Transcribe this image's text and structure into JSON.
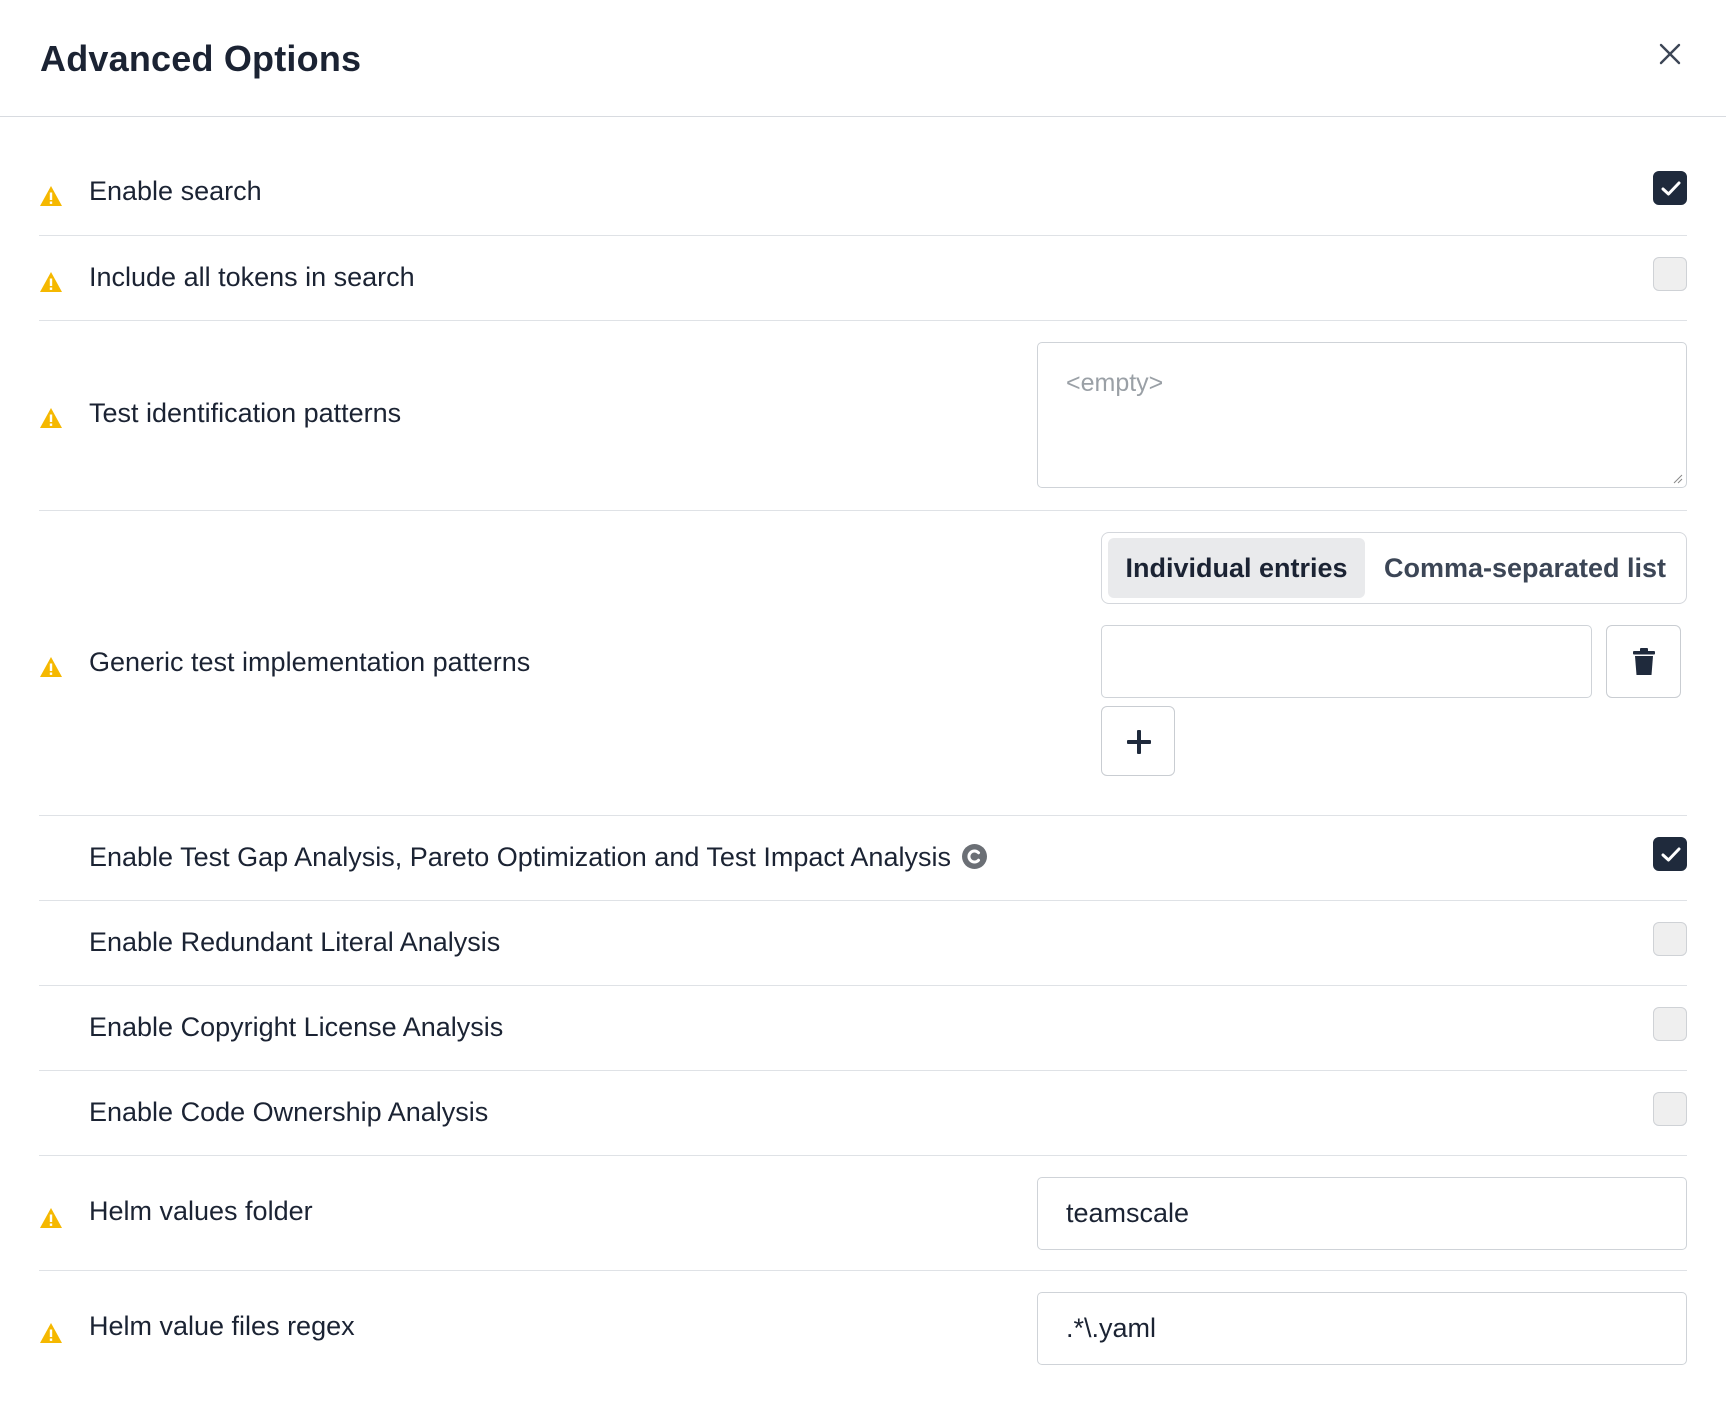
{
  "dialog": {
    "title": "Advanced Options",
    "close_icon": "close-icon"
  },
  "options": {
    "enable_search": {
      "label": "Enable search",
      "checked": true,
      "warning": true
    },
    "include_all_tokens": {
      "label": "Include all tokens in search",
      "checked": false,
      "warning": true
    },
    "test_identification_patterns": {
      "label": "Test identification patterns",
      "placeholder": "<empty>",
      "value": "",
      "warning": true
    },
    "generic_test_patterns": {
      "label": "Generic test implementation patterns",
      "warning": true,
      "modes": {
        "individual": "Individual entries",
        "comma": "Comma-separated list",
        "selected": "Individual entries"
      },
      "entry_value": "",
      "delete_icon": "trash-icon",
      "add_icon": "plus-icon"
    },
    "tga": {
      "label": "Enable Test Gap Analysis, Pareto Optimization and Test Impact Analysis",
      "checked": true,
      "badge_icon": "c-badge-icon"
    },
    "redundant_literal": {
      "label": "Enable Redundant Literal Analysis",
      "checked": false
    },
    "copyright_license": {
      "label": "Enable Copyright License Analysis",
      "checked": false
    },
    "code_ownership": {
      "label": "Enable Code Ownership Analysis",
      "checked": false
    },
    "helm_values_folder": {
      "label": "Helm values folder",
      "value": "teamscale",
      "warning": true
    },
    "helm_value_files_regex": {
      "label": "Helm value files regex",
      "value": ".*\\.yaml",
      "warning": true
    }
  },
  "colors": {
    "warning": "#f5b800",
    "checkbox_checked": "#1f2a3c",
    "text": "#1b2333",
    "border": "#cfd3d8"
  }
}
